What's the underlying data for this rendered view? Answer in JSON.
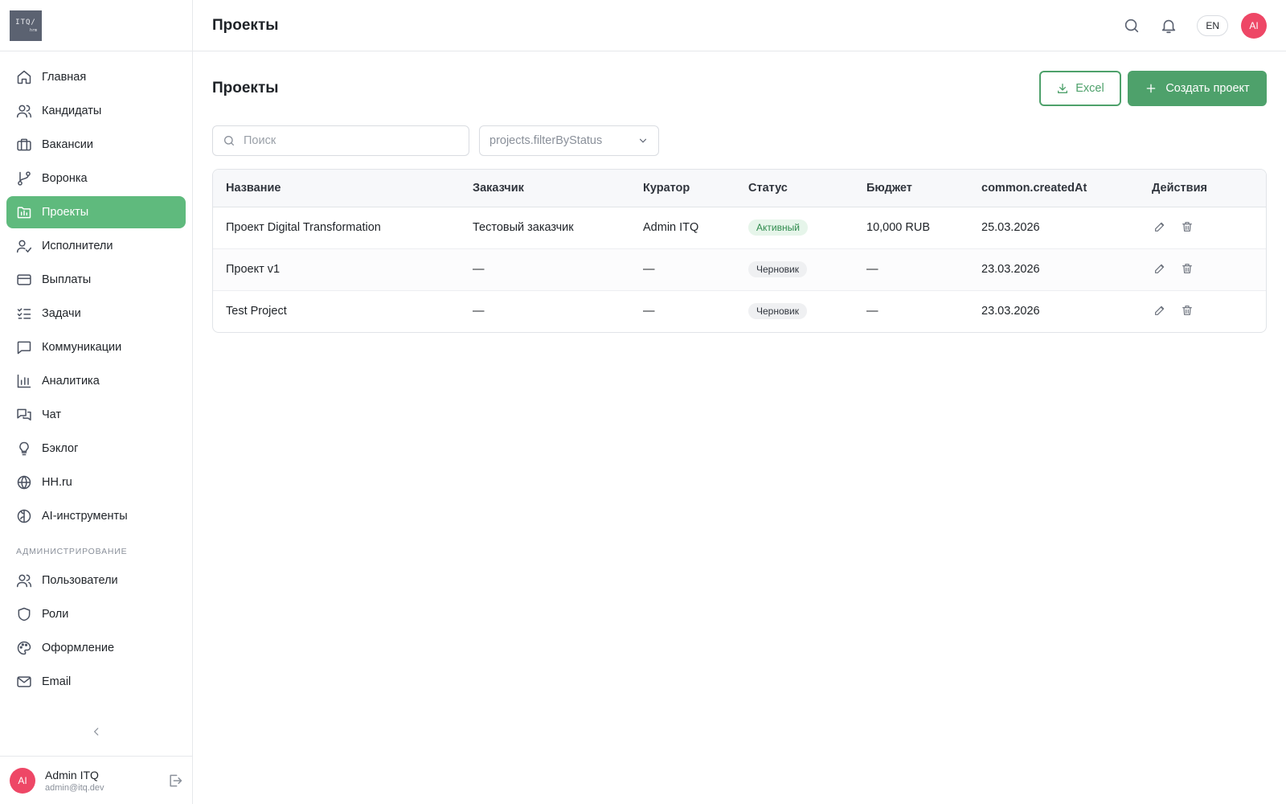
{
  "logo": {
    "line1": "ITQ/",
    "line2": "hrm"
  },
  "sidebar": {
    "items": [
      {
        "label": "Главная",
        "icon": "home-icon"
      },
      {
        "label": "Кандидаты",
        "icon": "users-icon"
      },
      {
        "label": "Вакансии",
        "icon": "briefcase-icon"
      },
      {
        "label": "Воронка",
        "icon": "git-branch-icon"
      },
      {
        "label": "Проекты",
        "icon": "folder-chart-icon",
        "active": true
      },
      {
        "label": "Исполнители",
        "icon": "user-check-icon"
      },
      {
        "label": "Выплаты",
        "icon": "credit-card-icon"
      },
      {
        "label": "Задачи",
        "icon": "list-checks-icon"
      },
      {
        "label": "Коммуникации",
        "icon": "message-square-icon"
      },
      {
        "label": "Аналитика",
        "icon": "bar-chart-icon"
      },
      {
        "label": "Чат",
        "icon": "messages-icon"
      },
      {
        "label": "Бэклог",
        "icon": "lightbulb-icon"
      },
      {
        "label": "HH.ru",
        "icon": "globe-icon"
      },
      {
        "label": "AI-инструменты",
        "icon": "brain-icon"
      }
    ],
    "admin_section": "АДМИНИСТРИРОВАНИЕ",
    "admin_items": [
      {
        "label": "Пользователи",
        "icon": "users-icon"
      },
      {
        "label": "Роли",
        "icon": "shield-icon"
      },
      {
        "label": "Оформление",
        "icon": "palette-icon"
      },
      {
        "label": "Email",
        "icon": "mail-icon"
      }
    ]
  },
  "user": {
    "initials": "AI",
    "name": "Admin ITQ",
    "email": "admin@itq.dev"
  },
  "header": {
    "title": "Проекты",
    "lang": "EN",
    "avatar_initials": "AI"
  },
  "main": {
    "title": "Проекты",
    "excel_label": "Excel",
    "create_label": "Создать проект",
    "search_placeholder": "Поиск",
    "status_filter": "projects.filterByStatus"
  },
  "table": {
    "columns": [
      "Название",
      "Заказчик",
      "Куратор",
      "Статус",
      "Бюджет",
      "common.createdAt",
      "Действия"
    ],
    "rows": [
      {
        "name": "Проект Digital Transformation",
        "client": "Тестовый заказчик",
        "curator": "Admin ITQ",
        "status": "Активный",
        "status_type": "active",
        "budget": "10,000 RUB",
        "created": "25.03.2026"
      },
      {
        "name": "Проект v1",
        "client": "—",
        "curator": "—",
        "status": "Черновик",
        "status_type": "draft",
        "budget": "—",
        "created": "23.03.2026"
      },
      {
        "name": "Test Project",
        "client": "—",
        "curator": "—",
        "status": "Черновик",
        "status_type": "draft",
        "budget": "—",
        "created": "23.03.2026"
      }
    ]
  },
  "colors": {
    "accent": "#4ea16b",
    "active_nav": "#5fba7d",
    "avatar": "#ee4766"
  }
}
